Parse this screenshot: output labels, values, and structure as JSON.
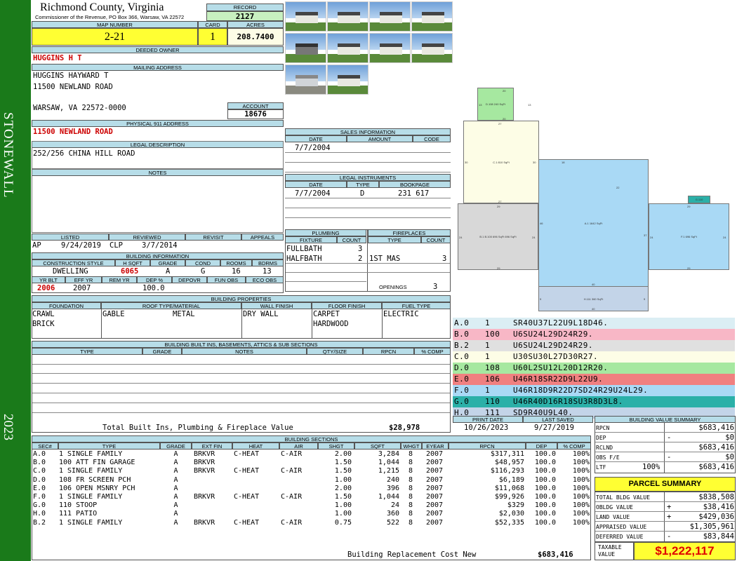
{
  "sidebar": {
    "district": "STONEWALL",
    "year": "2023"
  },
  "header": {
    "county": "Richmond County, Virginia",
    "commissioner": "Commissioner of the Revenue, PO Box 366, Warsaw, VA 22572"
  },
  "labels": {
    "record": "RECORD",
    "map_number": "MAP NUMBER",
    "card": "CARD",
    "acres": "ACRES",
    "deeded_owner": "DEEDED OWNER",
    "mailing_address": "MAILING ADDRESS",
    "account": "ACCOUNT",
    "physical_address": "PHYSICAL 911 ADDRESS",
    "legal_description": "LEGAL DESCRIPTION",
    "notes": "NOTES",
    "sales_info": "SALES INFORMATION",
    "date": "DATE",
    "amount": "AMOUNT",
    "code": "CODE",
    "legal_instruments": "LEGAL INSTRUMENTS",
    "type": "TYPE",
    "bookpage": "BOOKPAGE",
    "plumbing": "PLUMBING",
    "fixture": "FIXTURE",
    "count": "COUNT",
    "fireplaces": "FIREPLACES",
    "openings": "OPENINGS",
    "listed": "LISTED",
    "reviewed": "REVIEWED",
    "revisit": "REVISIT",
    "appeals": "APPEALS",
    "building_info": "BUILDING INFORMATION",
    "construction_style": "CONSTRUCTION STYLE",
    "h_sqft": "H SQFT",
    "grade": "GRADE",
    "cond": "COND",
    "rooms": "ROOMS",
    "bdrms": "BDRMS",
    "yr_blt": "YR BLT",
    "eff_yr": "EFF YR",
    "rem_yr": "REM YR",
    "dep_pct": "DEP %",
    "depovr": "DEPOVR",
    "fun_obs": "FUN OBS",
    "eco_obs": "ECO OBS",
    "building_properties": "BUILDING PROPERTIES",
    "foundation": "FOUNDATION",
    "roof": "ROOF TYPE/MATERIAL",
    "wall_finish": "WALL FINISH",
    "floor_finish": "FLOOR FINISH",
    "fuel_type": "FUEL TYPE",
    "built_ins": "BUILDING BUILT INS, BASEMENTS, ATTICS & SUB SECTIONS",
    "notes_col": "NOTES",
    "qty_size": "QTY/SIZE",
    "rpcn": "RPCN",
    "pct_comp": "% COMP",
    "print_date": "PRINT DATE",
    "last_saved": "LAST SAVED",
    "value_summary": "BUILDING VALUE SUMMARY",
    "building_sections": "BUILDING SECTIONS"
  },
  "record": "2127",
  "map_number": "2-21",
  "card": "1",
  "acres": "208.7400",
  "deeded_owner": "HUGGINS H T",
  "mailing": {
    "line1": "HUGGINS HAYWARD T",
    "line2": "11500 NEWLAND ROAD",
    "line3": "WARSAW, VA 22572-0000"
  },
  "account": "18676",
  "physical_address": "11500 NEWLAND ROAD",
  "legal_description": "252/256 CHINA HILL ROAD",
  "sales": [
    {
      "date": "7/7/2004",
      "amount": "",
      "code": ""
    }
  ],
  "instruments": [
    {
      "date": "7/7/2004",
      "type": "D",
      "bookpage": "231 617"
    }
  ],
  "plumbing": [
    {
      "fixture": "FULLBATH",
      "count": "3"
    },
    {
      "fixture": "HALFBATH",
      "count": "2"
    }
  ],
  "fireplaces": [
    {
      "type": "1ST MAS",
      "count": "3"
    }
  ],
  "openings": "3",
  "listed": {
    "by": "AP",
    "date": "9/24/2019"
  },
  "reviewed": {
    "by": "CLP",
    "date": "3/7/2014"
  },
  "building": {
    "style": "DWELLING",
    "h_sqft": "6065",
    "grade": "A",
    "cond": "G",
    "rooms": "16",
    "bdrms": "13",
    "yr_blt": "2006",
    "eff_yr": "2007",
    "rem_yr": "",
    "dep_pct": "100.0",
    "depovr": "",
    "fun_obs": "",
    "eco_obs": ""
  },
  "properties": {
    "foundation": [
      "CRAWL",
      "BRICK"
    ],
    "roof_type": "GABLE",
    "roof_material": "METAL",
    "wall": "DRY WALL",
    "floor": [
      "CARPET",
      "HARDWOOD"
    ],
    "fuel": "ELECTRIC"
  },
  "builtins_total": {
    "label": "Total Built Ins, Plumbing & Fireplace Value",
    "value": "$28,978"
  },
  "sketch_codes": [
    {
      "code": "A.0",
      "num": "1",
      "cmd": "SR40U37L22U9L18D46.",
      "color": "#dbeef4"
    },
    {
      "code": "B.0",
      "num": "100",
      "cmd": "U6SU24L29D24R29.",
      "color": "#f8b7c6"
    },
    {
      "code": "B.2",
      "num": "1",
      "cmd": "U6SU24L29D24R29.",
      "color": "#e0e0e0"
    },
    {
      "code": "C.0",
      "num": "1",
      "cmd": "U30SU30L27D30R27.",
      "color": "#fdfde6"
    },
    {
      "code": "D.0",
      "num": "108",
      "cmd": "U60L2SU12L20D12R20.",
      "color": "#a6e8a0"
    },
    {
      "code": "E.0",
      "num": "106",
      "cmd": "U46R18SR22D9L22U9.",
      "color": "#f08080"
    },
    {
      "code": "F.0",
      "num": "1",
      "cmd": "U46R18D9R22D7SD24R29U24L29.",
      "color": "#a9d9f5"
    },
    {
      "code": "G.0",
      "num": "110",
      "cmd": "U46R40D16R18SU3R8D3L8.",
      "color": "#2bb0a8"
    },
    {
      "code": "H.0",
      "num": "111",
      "cmd": "SD9R40U9L40.",
      "color": "#c3d4e8"
    }
  ],
  "print_date": "10/26/2023",
  "last_saved": "9/27/2019",
  "value_summary": [
    {
      "label": "RPCN",
      "sign": "",
      "value": "$683,416"
    },
    {
      "label": "DEP",
      "sign": "-",
      "value": "$0"
    },
    {
      "label": "RCLND",
      "sign": "",
      "value": "$683,416"
    },
    {
      "label": "OBS F/E",
      "sign": "-",
      "value": "$0"
    },
    {
      "label": "LTF",
      "pct": "100%",
      "sign": "",
      "value": "$683,416"
    }
  ],
  "parcel_summary": {
    "title": "PARCEL SUMMARY",
    "rows": [
      {
        "label": "TOTAL BLDG VALUE",
        "sign": "",
        "value": "$838,508"
      },
      {
        "label": "OBLDG VALUE",
        "sign": "+",
        "value": "$38,416"
      },
      {
        "label": "LAND VALUE",
        "sign": "+",
        "value": "$429,036"
      },
      {
        "label": "APPRAISED VALUE",
        "sign": "",
        "value": "$1,305,961"
      },
      {
        "label": "DEFERRED VALUE",
        "sign": "-",
        "value": "$83,844"
      }
    ],
    "taxable_label": "TAXABLE VALUE",
    "taxable_value": "$1,222,117"
  },
  "sections_header": [
    "SEC#",
    "TYPE",
    "GRADE",
    "EXT FIN",
    "HEAT",
    "AIR",
    "SHGT",
    "SQFT",
    "WHGT",
    "EYEAR",
    "RPCN",
    "DEP",
    "% COMP"
  ],
  "sections": [
    {
      "sec": "A.0",
      "type": "1 SINGLE FAMILY",
      "grade": "A",
      "ext": "BRKVR",
      "heat": "C-HEAT",
      "air": "C-AIR",
      "shgt": "2.00",
      "sqft": "3,284",
      "whgt": "8",
      "eyear": "2007",
      "rpcn": "$317,311",
      "dep": "100.0",
      "comp": "100%"
    },
    {
      "sec": "B.0",
      "type": "100 ATT FIN GARAGE",
      "grade": "A",
      "ext": "BRKVR",
      "heat": "",
      "air": "",
      "shgt": "1.50",
      "sqft": "1,044",
      "whgt": "8",
      "eyear": "2007",
      "rpcn": "$48,957",
      "dep": "100.0",
      "comp": "100%"
    },
    {
      "sec": "C.0",
      "type": "1 SINGLE FAMILY",
      "grade": "A",
      "ext": "BRKVR",
      "heat": "C-HEAT",
      "air": "C-AIR",
      "shgt": "1.50",
      "sqft": "1,215",
      "whgt": "8",
      "eyear": "2007",
      "rpcn": "$116,293",
      "dep": "100.0",
      "comp": "100%"
    },
    {
      "sec": "D.0",
      "type": "108 FR SCREEN PCH",
      "grade": "A",
      "ext": "",
      "heat": "",
      "air": "",
      "shgt": "1.00",
      "sqft": "240",
      "whgt": "8",
      "eyear": "2007",
      "rpcn": "$6,189",
      "dep": "100.0",
      "comp": "100%"
    },
    {
      "sec": "E.0",
      "type": "106 OPEN MSNRY PCH",
      "grade": "A",
      "ext": "",
      "heat": "",
      "air": "",
      "shgt": "2.00",
      "sqft": "396",
      "whgt": "8",
      "eyear": "2007",
      "rpcn": "$11,068",
      "dep": "100.0",
      "comp": "100%"
    },
    {
      "sec": "F.0",
      "type": "1 SINGLE FAMILY",
      "grade": "A",
      "ext": "BRKVR",
      "heat": "C-HEAT",
      "air": "C-AIR",
      "shgt": "1.50",
      "sqft": "1,044",
      "whgt": "8",
      "eyear": "2007",
      "rpcn": "$99,926",
      "dep": "100.0",
      "comp": "100%"
    },
    {
      "sec": "G.0",
      "type": "110 STOOP",
      "grade": "A",
      "ext": "",
      "heat": "",
      "air": "",
      "shgt": "1.00",
      "sqft": "24",
      "whgt": "8",
      "eyear": "2007",
      "rpcn": "$329",
      "dep": "100.0",
      "comp": "100%"
    },
    {
      "sec": "H.0",
      "type": "111 PATIO",
      "grade": "A",
      "ext": "",
      "heat": "",
      "air": "",
      "shgt": "1.00",
      "sqft": "360",
      "whgt": "8",
      "eyear": "2007",
      "rpcn": "$2,030",
      "dep": "100.0",
      "comp": "100%"
    },
    {
      "sec": "B.2",
      "type": "1 SINGLE FAMILY",
      "grade": "A",
      "ext": "BRKVR",
      "heat": "C-HEAT",
      "air": "C-AIR",
      "shgt": "0.75",
      "sqft": "522",
      "whgt": "8",
      "eyear": "2007",
      "rpcn": "$52,335",
      "dep": "100.0",
      "comp": "100%"
    }
  ],
  "replacement": {
    "label": "Building Replacement Cost New",
    "value": "$683,416"
  },
  "sketch_text": {
    "d_top": "20",
    "d_left": "13",
    "d_right": "13",
    "d_area": "D.108\n240 SqFt",
    "d_bottom": "20",
    "c_top": "27",
    "c_left": "30",
    "c_right": "30",
    "c_area": "C.1\n810 SqFt",
    "c_bottom": "27",
    "e_area": "E.106\n198 SqFt",
    "e_top": "18",
    "a_area": "A.1\n1642 SqFt",
    "a_left": "46",
    "a_right": "37",
    "a_top": "22",
    "b_area": "B.1  B.100\n696 SqFt  696 SqFt",
    "b_top": "29",
    "b_left": "24",
    "b_right": "24",
    "b_bottom": "29",
    "f_area": "F.1\n696 SqFt",
    "f_top": "29",
    "f_left": "24",
    "f_right": "24",
    "f_bottom": "29",
    "g_area": "G.110",
    "h_area": "H.111\n360 SqFt",
    "h_top": "40",
    "h_left": "9",
    "h_right": "9",
    "h_bottom": "40"
  }
}
